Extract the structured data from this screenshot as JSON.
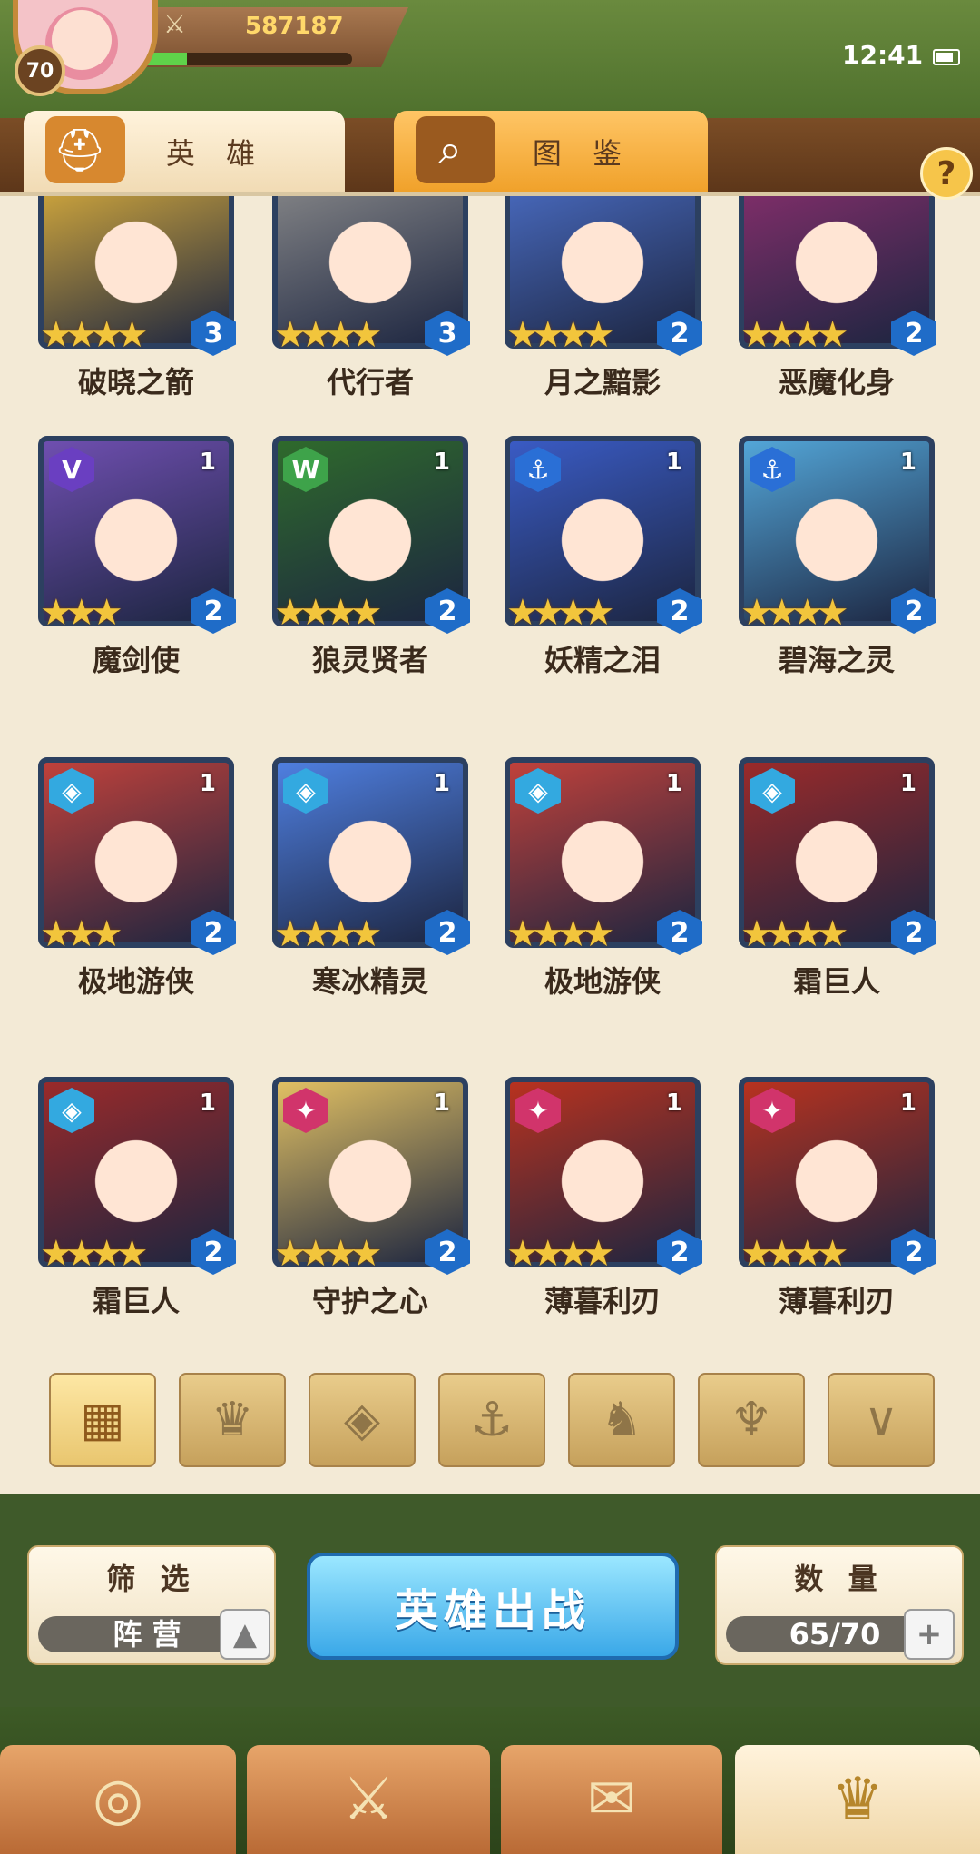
{
  "status": {
    "time": "12:41"
  },
  "player": {
    "level": "70",
    "gold": "587187",
    "exp_fraction": 0.24
  },
  "tabs": [
    {
      "label": "英 雄",
      "icon": "knight-helmet-icon"
    },
    {
      "label": "图 鉴",
      "icon": "magnifier-icon"
    }
  ],
  "help": {
    "label": "?"
  },
  "heroes": [
    {
      "name": "破晓之箭",
      "level": "3",
      "stars": "★★★★",
      "faction": "",
      "rank": "",
      "color": "#e0b23c"
    },
    {
      "name": "代行者",
      "level": "3",
      "stars": "★★★★",
      "faction": "",
      "rank": "",
      "color": "#8c8c8c"
    },
    {
      "name": "月之黯影",
      "level": "2",
      "stars": "★★★★",
      "faction": "",
      "rank": "",
      "color": "#4c6fc8"
    },
    {
      "name": "恶魔化身",
      "level": "2",
      "stars": "★★★★",
      "faction": "",
      "rank": "",
      "color": "#8b2f6e"
    },
    {
      "name": "魔剑使",
      "level": "2",
      "stars": "★★★",
      "faction": "V",
      "rank": "1",
      "color": "#6f4fb0"
    },
    {
      "name": "狼灵贤者",
      "level": "2",
      "stars": "★★★★",
      "faction": "W",
      "rank": "1",
      "color": "#2f6a2c"
    },
    {
      "name": "妖精之泪",
      "level": "2",
      "stars": "★★★★",
      "faction": "⚓",
      "rank": "1",
      "color": "#3a5bc4"
    },
    {
      "name": "碧海之灵",
      "level": "2",
      "stars": "★★★★",
      "faction": "⚓",
      "rank": "1",
      "color": "#53a6d8"
    },
    {
      "name": "极地游侠",
      "level": "2",
      "stars": "★★★",
      "faction": "◈",
      "rank": "1",
      "color": "#c0413b"
    },
    {
      "name": "寒冰精灵",
      "level": "2",
      "stars": "★★★★",
      "faction": "◈",
      "rank": "1",
      "color": "#4f7fe0"
    },
    {
      "name": "极地游侠",
      "level": "2",
      "stars": "★★★★",
      "faction": "◈",
      "rank": "1",
      "color": "#c0413b"
    },
    {
      "name": "霜巨人",
      "level": "2",
      "stars": "★★★★",
      "faction": "◈",
      "rank": "1",
      "color": "#9a2a2a"
    },
    {
      "name": "霜巨人",
      "level": "2",
      "stars": "★★★★",
      "faction": "◈",
      "rank": "1",
      "color": "#9a2a2a"
    },
    {
      "name": "守护之心",
      "level": "2",
      "stars": "★★★★",
      "faction": "✦",
      "rank": "1",
      "color": "#e1c063"
    },
    {
      "name": "薄暮利刃",
      "level": "2",
      "stars": "★★★★",
      "faction": "✦",
      "rank": "1",
      "color": "#b8321f"
    },
    {
      "name": "薄暮利刃",
      "level": "2",
      "stars": "★★★★",
      "faction": "✦",
      "rank": "1",
      "color": "#b8321f"
    }
  ],
  "faction_filters": [
    {
      "name": "all-grid-icon",
      "glyph": "▦"
    },
    {
      "name": "fire-crown-icon",
      "glyph": "♛"
    },
    {
      "name": "ice-diamond-icon",
      "glyph": "◈"
    },
    {
      "name": "anchor-icon",
      "glyph": "⚓"
    },
    {
      "name": "beast-head-icon",
      "glyph": "♞"
    },
    {
      "name": "demon-horns-icon",
      "glyph": "♆"
    },
    {
      "name": "dark-wings-icon",
      "glyph": "∨"
    }
  ],
  "filter": {
    "label": "筛 选",
    "value": "阵 营"
  },
  "battle_button": {
    "label": "英雄出战"
  },
  "count": {
    "label": "数 量",
    "value": "65/70"
  },
  "bottom_nav": [
    "portal-icon",
    "crossed-swords-icon",
    "scroll-map-icon",
    "crown-helm-icon"
  ]
}
